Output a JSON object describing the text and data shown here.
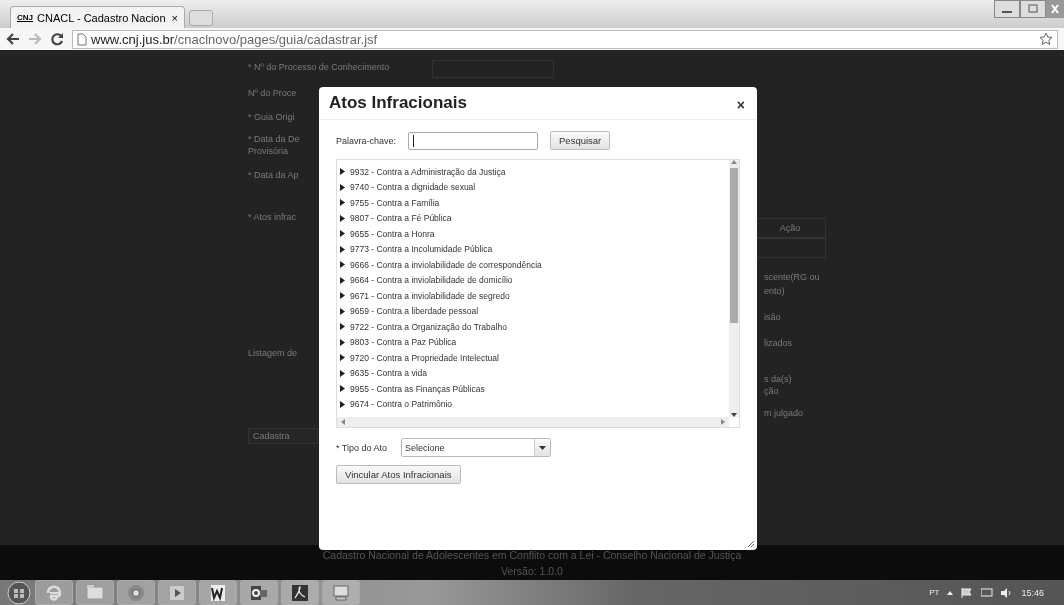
{
  "browser": {
    "tab": {
      "title": "CNACL - Cadastro Nacion",
      "logo": "CNJ",
      "close": "×"
    },
    "url": {
      "host": "www.cnj.jus.br",
      "path": "/cnaclnovo/pages/guia/cadastrar.jsf"
    }
  },
  "form": {
    "left_labels": [
      "* Nº do Processo de Conhecimento",
      "Nº do Proce",
      "* Guia Origi",
      "* Data da De",
      "Provisória",
      "* Data da Ap",
      "* Atos infrac",
      "Listagem de"
    ],
    "right_labels": [
      "scente(RG ou",
      "ento)",
      "isão",
      "lizados",
      "s da(s)",
      "ção",
      "m julgado"
    ],
    "table_header": "Ação",
    "submit": "Cadastra"
  },
  "dialog": {
    "title": "Atos Infracionais",
    "close": "×",
    "keyword_label": "Palavra-chave:",
    "search_button": "Pesquisar",
    "items": [
      {
        "label": "9932 - Contra a Administração da Justiça",
        "expanded": false
      },
      {
        "label": "9740 - Contra a dignidade sexual",
        "expanded": false
      },
      {
        "label": "9755 - Contra a Família",
        "expanded": false
      },
      {
        "label": "9807 - Contra a Fé Pública",
        "expanded": false
      },
      {
        "label": "9655 - Contra a Honra",
        "expanded": false
      },
      {
        "label": "9773 - Contra a Incolumidade Pública",
        "expanded": false
      },
      {
        "label": "9666 - Contra a inviolabilidade de correspondência",
        "expanded": false
      },
      {
        "label": "9664 - Contra a inviolabilidade de domicílio",
        "expanded": false
      },
      {
        "label": "9671 - Contra a inviolabilidade de segredo",
        "expanded": false
      },
      {
        "label": "9659 - Contra a liberdade pessoal",
        "expanded": false
      },
      {
        "label": "9722 - Contra a Organização do Trabalho",
        "expanded": false
      },
      {
        "label": "9803 - Contra a Paz Pública",
        "expanded": false
      },
      {
        "label": "9720 - Contra a Propriedade Intelectual",
        "expanded": false
      },
      {
        "label": "9635 - Contra a vida",
        "expanded": false
      },
      {
        "label": "9955 - Contra as Finanças Públicas",
        "expanded": false
      },
      {
        "label": "9674 - Contra o Patrimônio",
        "expanded": false
      }
    ],
    "type_label": "* Tipo do Ato",
    "type_value": "Selecione",
    "link_button": "Vincular Atos Infracionais"
  },
  "footer": {
    "line1": "Cadastro Nacional de Adolescentes em Conflito com a Lei - Conselho Nacional de Justiça",
    "line2": "Versão: 1.0.0"
  },
  "taskbar": {
    "language": "PT",
    "time": "15:46"
  }
}
